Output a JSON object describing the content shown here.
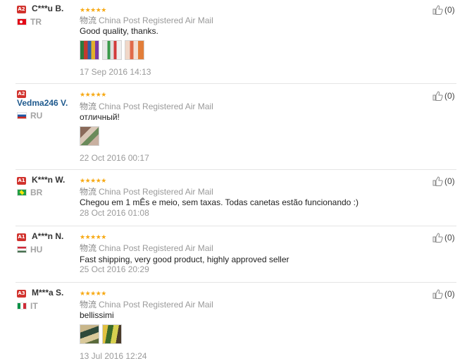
{
  "ship_cn": "物流",
  "colors": {
    "star": "#f7a914",
    "level_badge": "#d1322d",
    "name_blue": "#1f5a8e"
  },
  "icons": {
    "like": "thumbs-up-icon",
    "rating": "star-icon",
    "flag": "country-flag-icon"
  },
  "reviews": [
    {
      "level": "A2",
      "name": "C***u B.",
      "country": "TR",
      "stars": "★★★★★",
      "shipping": "China Post Registered Air Mail",
      "text": "Good quality, thanks.",
      "photos": 3,
      "date": "17 Sep 2016 14:13",
      "likes": "(0)"
    },
    {
      "level": "A2",
      "name": "Vedma246 V.",
      "country": "RU",
      "stars": "★★★★★",
      "shipping": "China Post Registered Air Mail",
      "text": "отличный!",
      "photos": 1,
      "date": "22 Oct 2016 00:17",
      "likes": "(0)"
    },
    {
      "level": "A1",
      "name": "K***n W.",
      "country": "BR",
      "stars": "★★★★★",
      "shipping": "China Post Registered Air Mail",
      "text": "Chegou em 1 mÊs e meio, sem taxas. Todas canetas estão funcionando :)",
      "photos": 0,
      "date": "28 Oct 2016 01:08",
      "likes": "(0)"
    },
    {
      "level": "A1",
      "name": "A***n N.",
      "country": "HU",
      "stars": "★★★★★",
      "shipping": "China Post Registered Air Mail",
      "text": "Fast shipping, very good product, highly approved seller",
      "photos": 0,
      "date": "25 Oct 2016 20:29",
      "likes": "(0)"
    },
    {
      "level": "A3",
      "name": "M***a S.",
      "country": "IT",
      "stars": "★★★★★",
      "shipping": "China Post Registered Air Mail",
      "text": "bellissimi",
      "photos": 2,
      "date": "13 Jul 2016 12:24",
      "likes": "(0)"
    }
  ]
}
